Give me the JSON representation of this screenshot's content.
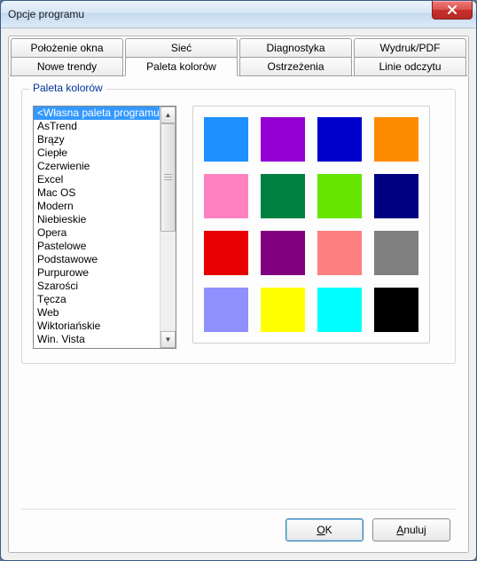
{
  "window": {
    "title": "Opcje programu"
  },
  "tabs_row1": [
    {
      "label": "Położenie okna"
    },
    {
      "label": "Sieć"
    },
    {
      "label": "Diagnostyka"
    },
    {
      "label": "Wydruk/PDF"
    }
  ],
  "tabs_row2": [
    {
      "label": "Nowe trendy"
    },
    {
      "label": "Paleta kolorów",
      "selected": true
    },
    {
      "label": "Ostrzeżenia"
    },
    {
      "label": "Linie odczytu"
    }
  ],
  "groupbox": {
    "title": "Paleta kolorów"
  },
  "palette_list": [
    "<Własna paleta programu>",
    "AsTrend",
    "Brązy",
    "Ciepłe",
    "Czerwienie",
    "Excel",
    "Mac OS",
    "Modern",
    "Niebieskie",
    "Opera",
    "Pastelowe",
    "Podstawowe",
    "Purpurowe",
    "Szarości",
    "Tęcza",
    "Web",
    "Wiktoriańskie",
    "Win. Vista"
  ],
  "selected_palette_index": 0,
  "swatches": [
    "#1e90ff",
    "#9400d3",
    "#0000cd",
    "#ff8c00",
    "#ff82c0",
    "#008040",
    "#66e600",
    "#000080",
    "#e60000",
    "#800080",
    "#ff8080",
    "#808080",
    "#9090ff",
    "#ffff00",
    "#00ffff",
    "#000000"
  ],
  "buttons": {
    "ok_prefix": "O",
    "ok_rest": "K",
    "cancel_prefix": "A",
    "cancel_rest": "nuluj"
  }
}
